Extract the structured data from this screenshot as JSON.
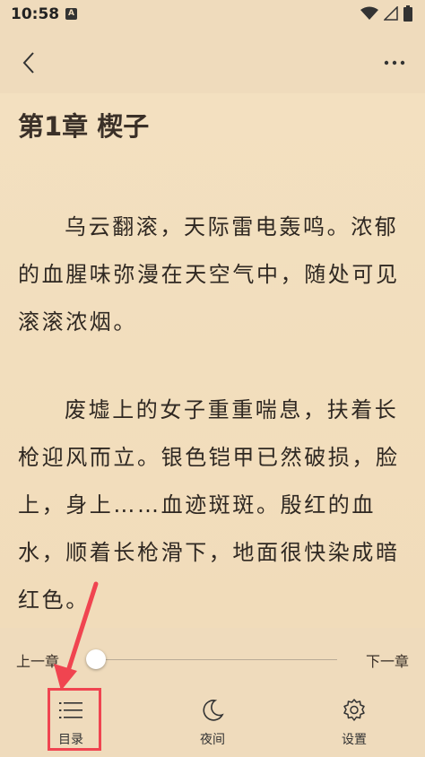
{
  "status_bar": {
    "time": "10:58",
    "badge": "A"
  },
  "top_bar": {
    "back_icon": "chevron-left-icon",
    "more_icon": "more-horizontal-icon"
  },
  "chapter": {
    "title": "第1章 楔子",
    "paragraphs": [
      "乌云翻滚，天际雷电轰鸣。浓郁的血腥味弥漫在天空气中，随处可见滚滚浓烟。",
      "废墟上的女子重重喘息，扶着长枪迎风而立。银色铠甲已然破损，脸上，身上……血迹斑斑。殷红的血水，顺着长枪滑下，地面很快染成暗红色。"
    ]
  },
  "progress": {
    "prev_label": "上一章",
    "next_label": "下一章",
    "value": 0.0
  },
  "bottom_nav": {
    "toc_label": "目录",
    "night_label": "夜间",
    "settings_label": "设置"
  },
  "colors": {
    "background": "#f0dcbc",
    "highlight": "#f04450",
    "text": "#2f2822"
  }
}
